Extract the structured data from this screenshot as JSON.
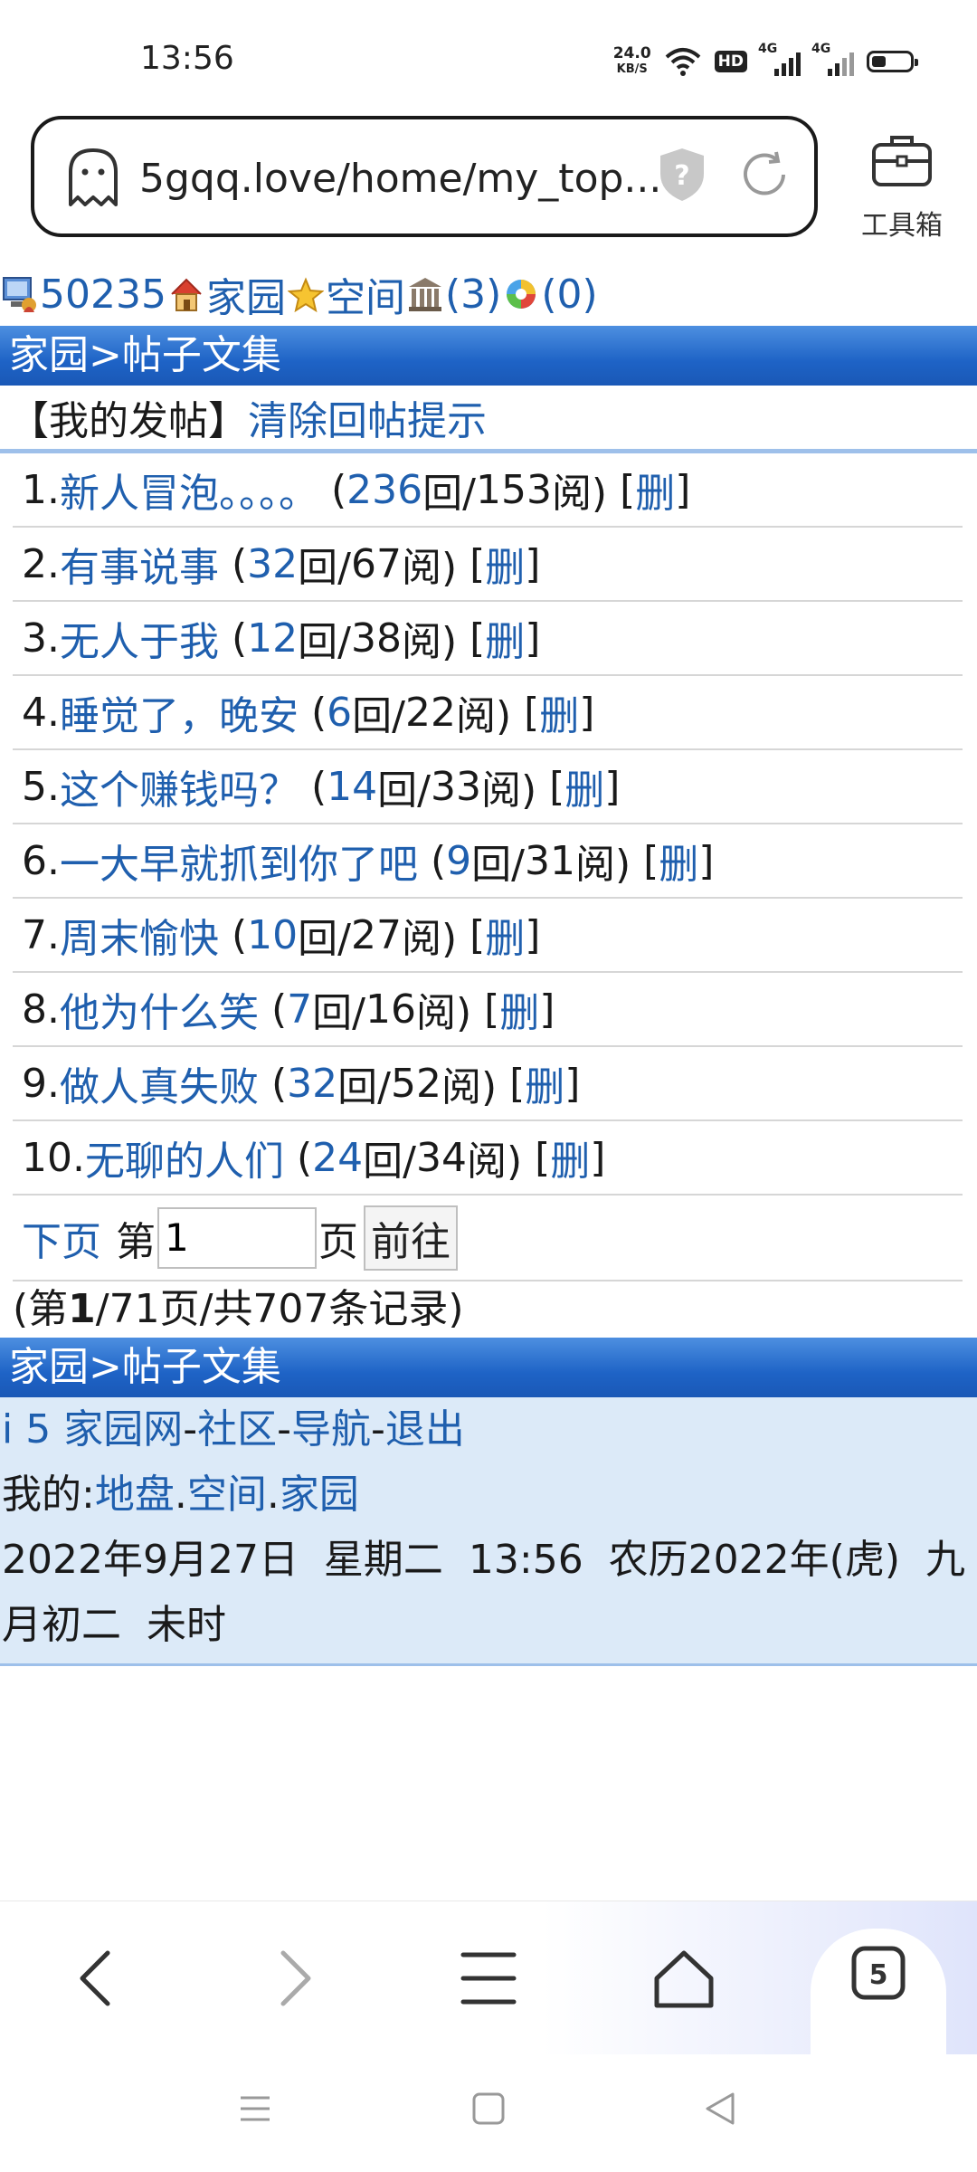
{
  "status_bar": {
    "time": "13:56",
    "net_speed_value": "24.0",
    "net_speed_unit": "KB/S",
    "hd_badge": "HD",
    "signal_label": "4G"
  },
  "browser": {
    "url": "5gqq.love/home/my_top...",
    "toolbox_label": "工具箱",
    "tab_count": "5"
  },
  "top_links": {
    "user_id": "50235",
    "home": "家园",
    "space": "空间",
    "bank_count": "(3)",
    "bubble_count": "(0)"
  },
  "breadcrumb": "家园>帖子文集",
  "subheader": {
    "my_posts": "【我的发帖】",
    "clear_reply_alert": "清除回帖提示"
  },
  "posts": [
    {
      "index": "1.",
      "title": "新人冒泡。。。。",
      "replies": "236",
      "views": "153"
    },
    {
      "index": "2.",
      "title": " 有事说事",
      "replies": "32",
      "views": "67"
    },
    {
      "index": "3.",
      "title": "无人于我",
      "replies": "12",
      "views": "38"
    },
    {
      "index": "4.",
      "title": "睡觉了，晚安",
      "replies": "6",
      "views": "22"
    },
    {
      "index": "5.",
      "title": "这个赚钱吗？",
      "replies": "14",
      "views": "33"
    },
    {
      "index": "6.",
      "title": "一大早就抓到你了吧",
      "replies": "9",
      "views": "31"
    },
    {
      "index": "7.",
      "title": "周末愉快",
      "replies": "10",
      "views": "27"
    },
    {
      "index": "8.",
      "title": "他为什么笑",
      "replies": "7",
      "views": "16"
    },
    {
      "index": "9.",
      "title": "做人真失败",
      "replies": "32",
      "views": "52"
    },
    {
      "index": "10.",
      "title": "无聊的人们",
      "replies": "24",
      "views": "34"
    }
  ],
  "post_labels": {
    "replies_suffix": "回/",
    "views_suffix": "阅)",
    "delete": "删"
  },
  "pagination": {
    "next": "下页",
    "page_prefix": "第",
    "page_value": "1",
    "page_suffix": "页",
    "go": "前往",
    "summary_prefix": "(第",
    "current_page": "1",
    "summary_suffix": "/71页/共707条记录)"
  },
  "footer": {
    "site_prefix": "i 5 ",
    "site_home": "家园网",
    "community": "社区",
    "navigation": "导航",
    "logout": "退出",
    "my_label": "我的:",
    "territory": "地盘",
    "space": "空间",
    "homeland": "家园",
    "datetime": "2022年9月27日  星期二  13:56  农历2022年(虎)  九",
    "datetime_cont": "月初二  未时"
  },
  "colors": {
    "link": "#1f5fae",
    "title_bar": "#1e63c6",
    "footer_bg": "#dceaf8"
  }
}
